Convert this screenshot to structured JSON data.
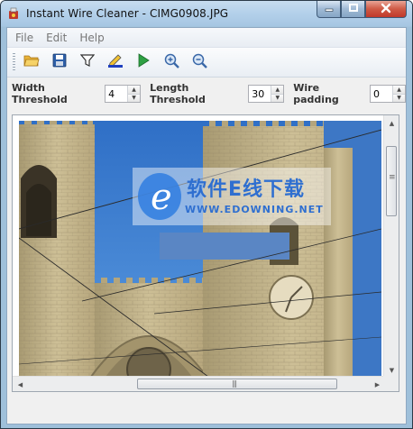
{
  "window": {
    "title": "Instant Wire Cleaner - CIMG0908.JPG",
    "caption_buttons": {
      "minimize_icon": "minimize-icon",
      "maximize_icon": "maximize-icon",
      "close_icon": "close-icon"
    }
  },
  "menu": {
    "items": [
      {
        "label": "File"
      },
      {
        "label": "Edit"
      },
      {
        "label": "Help"
      }
    ]
  },
  "toolbar": {
    "buttons": [
      {
        "icon": "open-folder-icon"
      },
      {
        "icon": "save-disk-icon"
      },
      {
        "icon": "filter-funnel-icon"
      },
      {
        "icon": "draw-pen-icon"
      },
      {
        "icon": "play-icon"
      },
      {
        "icon": "zoom-in-icon"
      },
      {
        "icon": "zoom-out-icon"
      }
    ]
  },
  "params": {
    "width_threshold": {
      "label": "Width Threshold",
      "value": "4"
    },
    "length_threshold": {
      "label": "Length Threshold",
      "value": "30"
    },
    "wire_padding": {
      "label": "Wire padding",
      "value": "0"
    }
  },
  "image": {
    "description_icon": "cathedral-photo",
    "watermark": {
      "line1": "软件E线下载",
      "line2": "WWW.EDOWNING.NET"
    }
  },
  "colors": {
    "sky": "#3b79c9",
    "stone": "#c9b98e",
    "accent_blue": "#5a86c4"
  }
}
